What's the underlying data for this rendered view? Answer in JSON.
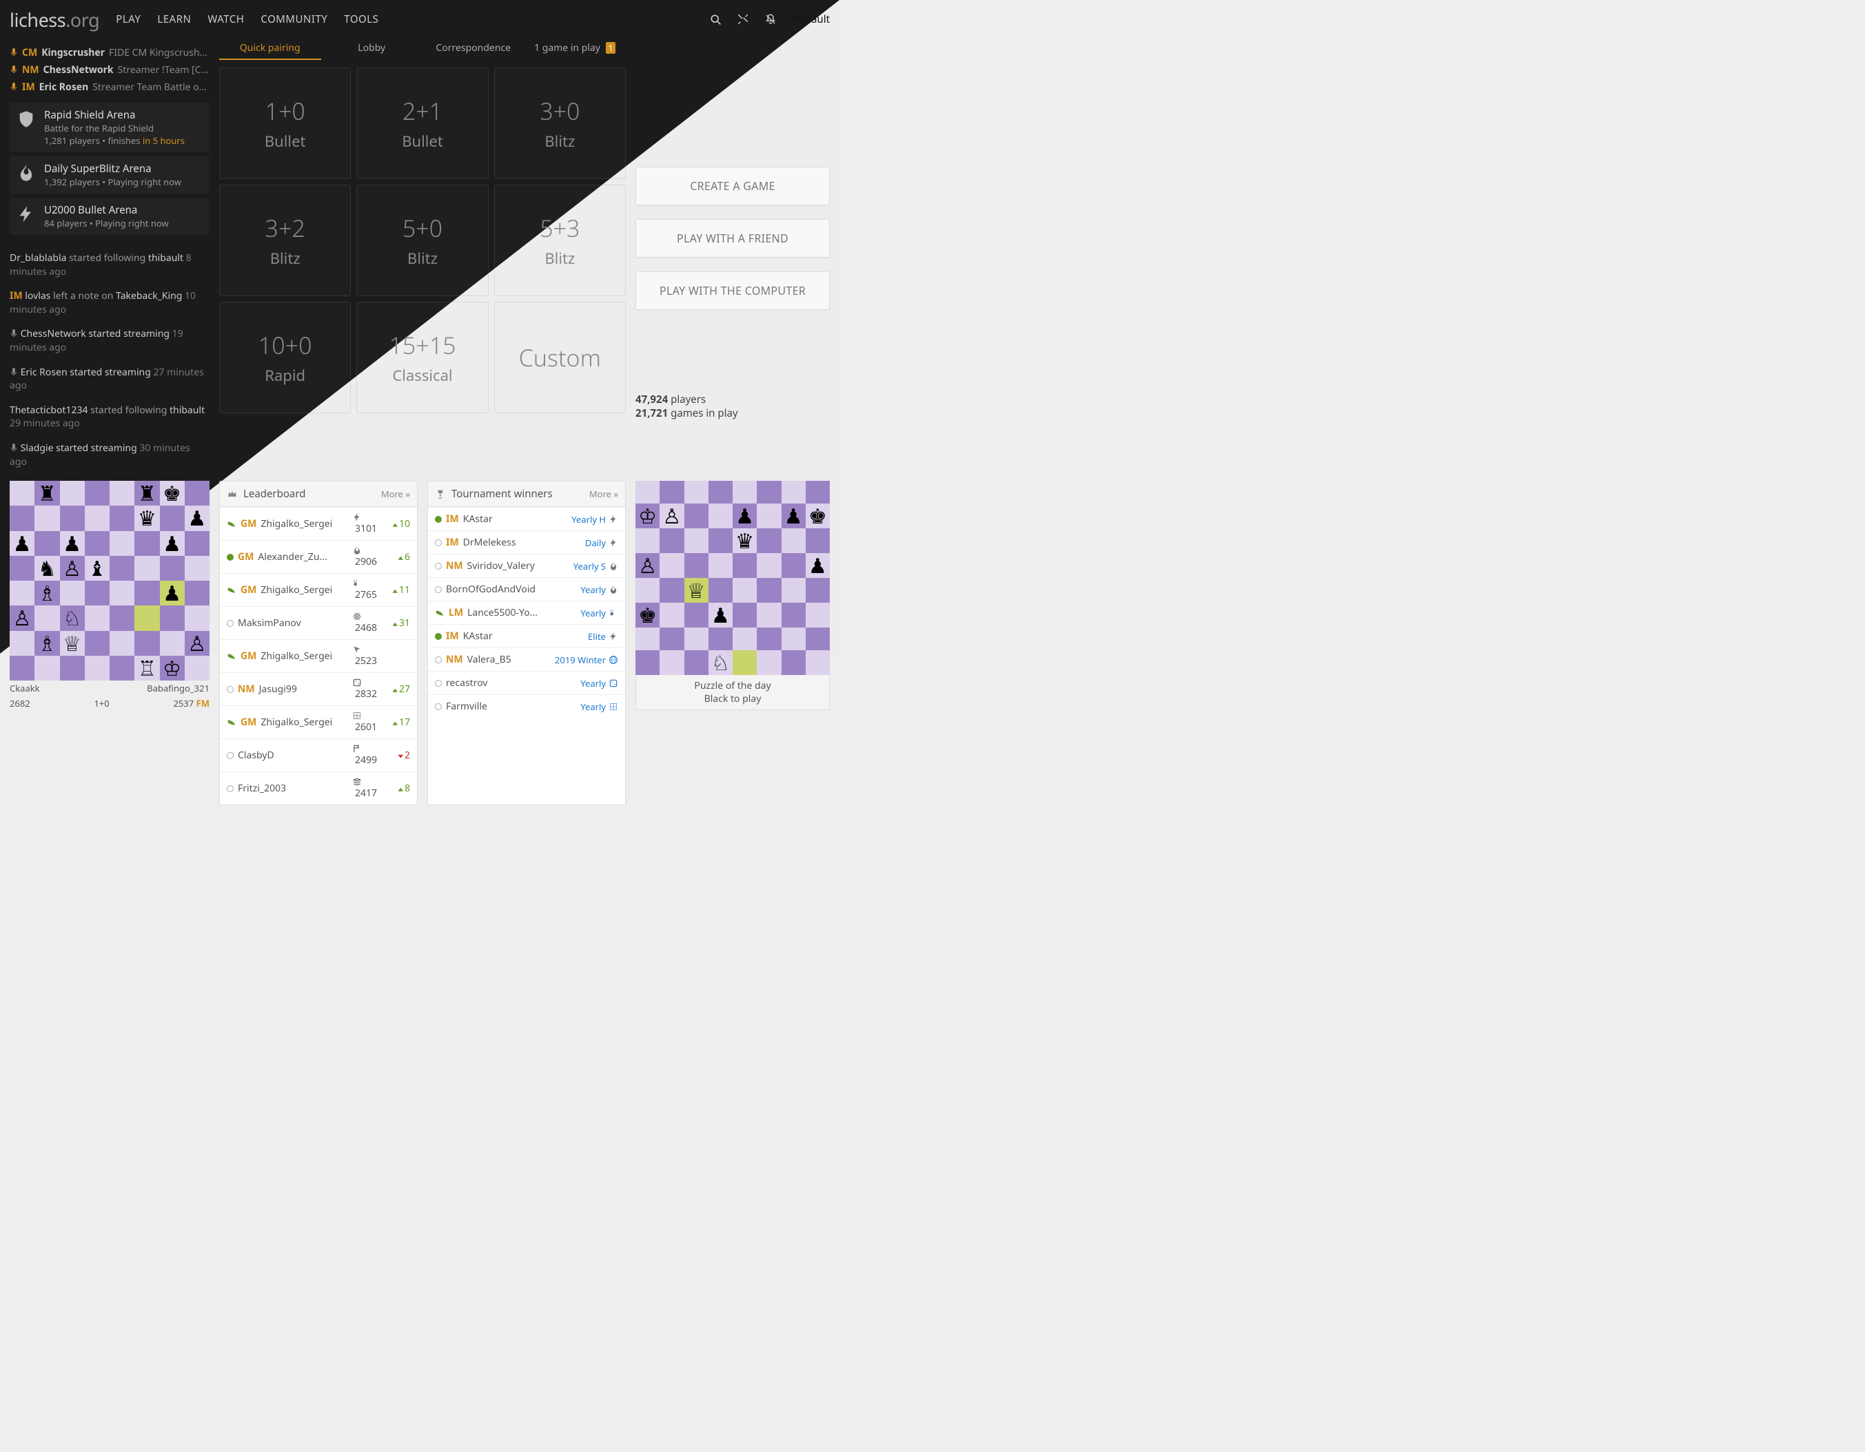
{
  "brand": {
    "main": "lichess",
    "suffix": ".org"
  },
  "nav": [
    "PLAY",
    "LEARN",
    "WATCH",
    "COMMUNITY",
    "TOOLS"
  ],
  "user": "thibault",
  "streamers": [
    {
      "title": "CM",
      "name": "Kingscrusher",
      "desc": "FIDE CM Kingscrusher pla..."
    },
    {
      "title": "NM",
      "name": "ChessNetwork",
      "desc": "Streamer !Team [Chess..."
    },
    {
      "title": "IM",
      "name": "Eric Rosen",
      "desc": "Streamer Team Battle on liche..."
    }
  ],
  "events": [
    {
      "icon": "shield",
      "title": "Rapid Shield Arena",
      "sub1": "Battle for the Rapid Shield",
      "sub2": "1,281 players • finishes",
      "sub2_hl": "in 5 hours"
    },
    {
      "icon": "flame",
      "title": "Daily SuperBlitz Arena",
      "sub2": "1,392 players • Playing right now"
    },
    {
      "icon": "bolt",
      "title": "U2000 Bullet Arena",
      "sub2": "84 players • Playing right now"
    }
  ],
  "timeline": [
    {
      "pre": "",
      "u1": "Dr_blablabla",
      "mid": " started following ",
      "u2": "thibault",
      "ago": "8 minutes ago"
    },
    {
      "pre": "IM ",
      "u1": "lovlas",
      "mid": " left a note on ",
      "u2": "Takeback_King",
      "ago": "10 minutes ago",
      "imTitle": true
    },
    {
      "icon": "mic",
      "u1": "ChessNetwork started streaming",
      "ago": "19 minutes ago"
    },
    {
      "icon": "mic",
      "u1": "Eric Rosen started streaming",
      "ago": "27 minutes ago"
    },
    {
      "pre": "",
      "u1": "Thetacticbot1234",
      "mid": " started following ",
      "u2": "thibault",
      "ago": "29 minutes ago"
    },
    {
      "icon": "mic",
      "u1": "Sladgie started streaming",
      "ago": "30 minutes ago"
    }
  ],
  "lobby_tabs": {
    "t1": "Quick pairing",
    "t2": "Lobby",
    "t3": "Correspondence",
    "t4_pre": "1 game in play",
    "t4_badge": "1"
  },
  "qp": [
    {
      "tc": "1+0",
      "cat": "Bullet"
    },
    {
      "tc": "2+1",
      "cat": "Bullet"
    },
    {
      "tc": "3+0",
      "cat": "Blitz"
    },
    {
      "tc": "3+2",
      "cat": "Blitz"
    },
    {
      "tc": "5+0",
      "cat": "Blitz"
    },
    {
      "tc": "5+3",
      "cat": "Blitz"
    },
    {
      "tc": "10+0",
      "cat": "Rapid"
    },
    {
      "tc": "15+15",
      "cat": "Classical"
    },
    {
      "tc": "Custom",
      "cat": ""
    }
  ],
  "big_buttons": [
    "CREATE A GAME",
    "PLAY WITH A FRIEND",
    "PLAY WITH THE COMPUTER"
  ],
  "stats": {
    "players": "47,924",
    "players_lbl": "players",
    "games": "21,721",
    "games_lbl": "games in play"
  },
  "featured": {
    "white": "Ckaakk",
    "white_elo": "2682",
    "tc": "1+0",
    "black": "Babafingo_321",
    "black_elo": "2537",
    "black_title": "FM",
    "fen_rows": [
      ". r . . . r k .",
      ". . . . . q . p",
      "p . p . . . p .",
      ". n P b . . . .",
      ". B . . . . p .",
      "P . N . . . . .",
      ". B Q . . . . P",
      ". . . . . R K ."
    ],
    "hl": [
      "f3",
      "g4"
    ]
  },
  "leaderboard": {
    "title": "Leaderboard",
    "more": "More »",
    "rows": [
      {
        "w": true,
        "p": true,
        "t": "GM",
        "n": "Zhigalko_Sergei",
        "i": "bolt",
        "r": "3101",
        "d": "10"
      },
      {
        "on": true,
        "p": false,
        "t": "GM",
        "n": "Alexander_Zu...",
        "i": "flame",
        "r": "2906",
        "d": "6"
      },
      {
        "w": true,
        "p": true,
        "t": "GM",
        "n": "Zhigalko_Sergei",
        "i": "rabbit",
        "r": "2765",
        "d": "11"
      },
      {
        "off": true,
        "t": "",
        "n": "MaksimPanov",
        "i": "atom",
        "r": "2468",
        "d": "31"
      },
      {
        "w": true,
        "p": true,
        "t": "GM",
        "n": "Zhigalko_Sergei",
        "i": "cursor",
        "r": "2523",
        "d": ""
      },
      {
        "off": true,
        "t": "NM",
        "n": "Jasugi99",
        "i": "die",
        "r": "2832",
        "d": "27"
      },
      {
        "w": true,
        "p": true,
        "t": "GM",
        "n": "Zhigalko_Sergei",
        "i": "grid",
        "r": "2601",
        "d": "17"
      },
      {
        "off": true,
        "t": "",
        "n": "ClasbyD",
        "i": "flag",
        "r": "2499",
        "d": "2",
        "neg": true
      },
      {
        "off": true,
        "t": "",
        "n": "Fritzi_2003",
        "i": "stack",
        "r": "2417",
        "d": "8"
      }
    ]
  },
  "winners": {
    "title": "Tournament winners",
    "more": "More »",
    "rows": [
      {
        "on": true,
        "t": "IM",
        "n": "KAstar",
        "link": "Yearly H",
        "i": "bolt"
      },
      {
        "off": true,
        "t": "IM",
        "n": "DrMelekess",
        "link": "Daily",
        "i": "bolt"
      },
      {
        "off": true,
        "t": "NM",
        "n": "Sviridov_Valery",
        "link": "Yearly S",
        "i": "flame"
      },
      {
        "off": true,
        "t": "",
        "n": "BornOfGodAndVoid",
        "link": "Yearly",
        "i": "flame"
      },
      {
        "w": true,
        "t": "LM",
        "n": "Lance5500-Yo...",
        "link": "Yearly",
        "i": "rabbit"
      },
      {
        "on": true,
        "t": "IM",
        "n": "KAstar",
        "link": "Elite",
        "i": "bolt"
      },
      {
        "off": true,
        "t": "NM",
        "n": "Valera_B5",
        "link": "2019 Winter",
        "i": "globe"
      },
      {
        "off": true,
        "t": "",
        "n": "recastrov",
        "link": "Yearly",
        "i": "die"
      },
      {
        "off": true,
        "t": "",
        "n": "Farmville",
        "link": "Yearly",
        "i": "grid"
      }
    ]
  },
  "potd": {
    "title": "Puzzle of the day",
    "sub": "Black to play",
    "fen_rows": [
      ". . . . . . . .",
      "K P . . p . p k",
      ". . . . q . . .",
      "P . . . . . . p",
      ". . Q . . . . .",
      "k . . p . . . .",
      ". . . . . . . .",
      ". . . N . . . ."
    ],
    "hl": [
      "c4",
      "e1"
    ]
  }
}
